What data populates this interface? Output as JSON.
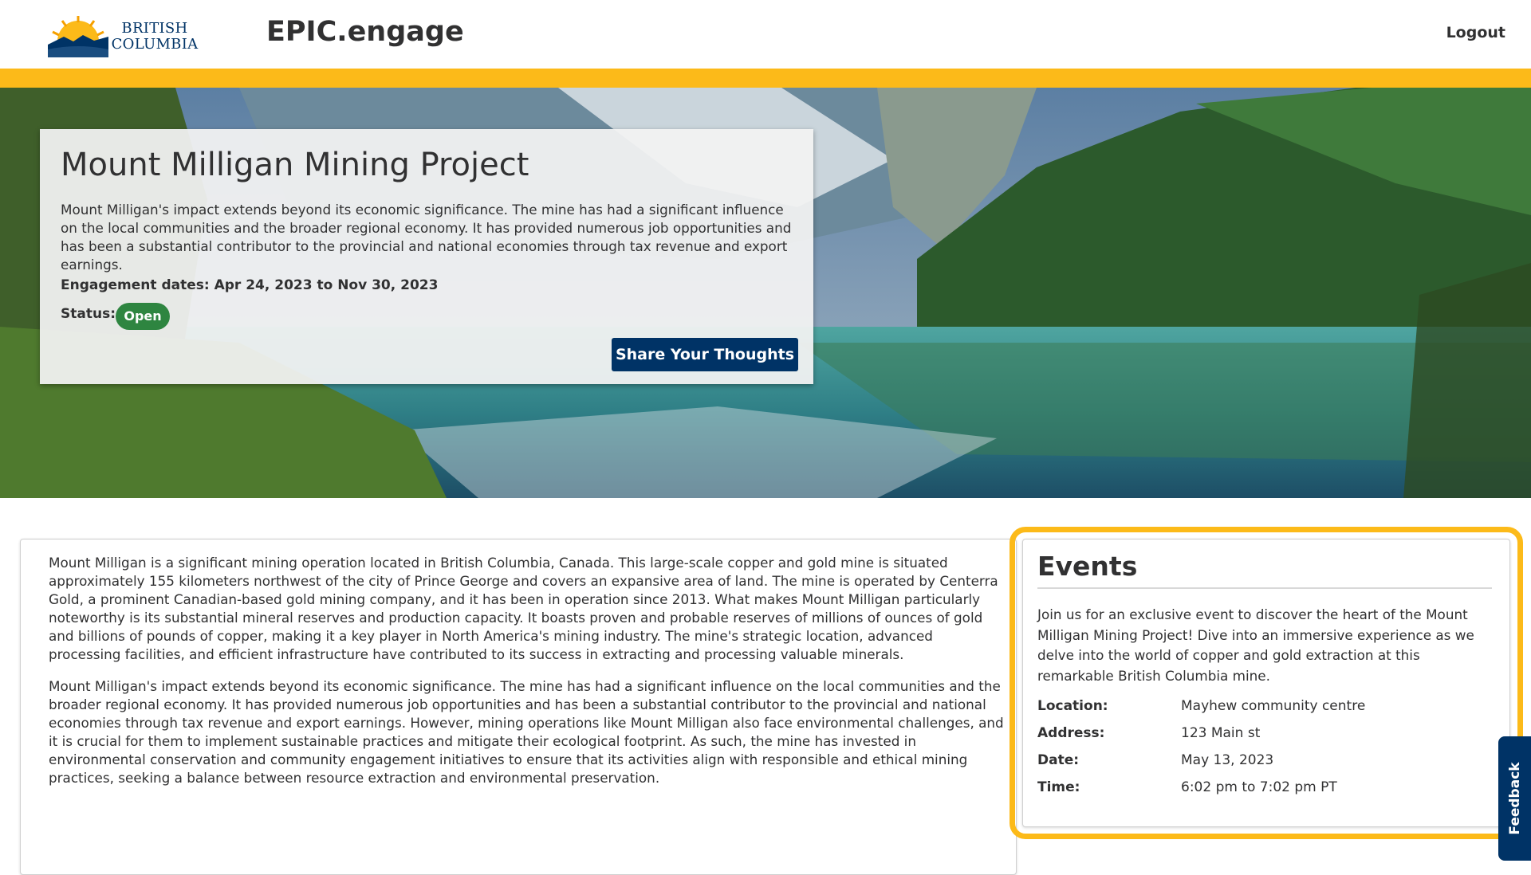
{
  "header": {
    "logo_line1": "BRITISH",
    "logo_line2": "COLUMBIA",
    "site_title": "EPIC.engage",
    "logout_label": "Logout"
  },
  "hero": {
    "title": "Mount Milligan Mining Project",
    "description": "Mount Milligan's impact extends beyond its economic significance. The mine has had a significant influence on the local communities and the broader regional economy. It has provided numerous job opportunities and has been a substantial contributor to the provincial and national economies through tax revenue and export earnings.",
    "engagement_dates": "Engagement dates: Apr 24, 2023 to Nov 30, 2023",
    "status_label": "Status:",
    "status_value": "Open",
    "cta_label": "Share Your Thoughts"
  },
  "content": {
    "paragraphs": [
      "Mount Milligan is a significant mining operation located in British Columbia, Canada. This large-scale copper and gold mine is situated approximately 155 kilometers northwest of the city of Prince George and covers an expansive area of land. The mine is operated by Centerra Gold, a prominent Canadian-based gold mining company, and it has been in operation since 2013. What makes Mount Milligan particularly noteworthy is its substantial mineral reserves and production capacity. It boasts proven and probable reserves of millions of ounces of gold and billions of pounds of copper, making it a key player in North America's mining industry. The mine's strategic location, advanced processing facilities, and efficient infrastructure have contributed to its success in extracting and processing valuable minerals.",
      "Mount Milligan's impact extends beyond its economic significance. The mine has had a significant influence on the local communities and the broader regional economy. It has provided numerous job opportunities and has been a substantial contributor to the provincial and national economies through tax revenue and export earnings. However, mining operations like Mount Milligan also face environmental challenges, and it is crucial for them to implement sustainable practices and mitigate their ecological footprint. As such, the mine has invested in environmental conservation and community engagement initiatives to ensure that its activities align with responsible and ethical mining practices, seeking a balance between resource extraction and environmental preservation."
    ]
  },
  "events": {
    "title": "Events",
    "description": "Join us for an exclusive event to discover the heart of the Mount Milligan Mining Project! Dive into an immersive experience as we delve into the world of copper and gold extraction at this remarkable British Columbia mine.",
    "details": [
      {
        "label": "Location:",
        "value": "Mayhew community centre"
      },
      {
        "label": "Address:",
        "value": "123 Main st"
      },
      {
        "label": "Date:",
        "value": "May 13, 2023"
      },
      {
        "label": "Time:",
        "value": "6:02 pm to 7:02 pm PT"
      }
    ]
  },
  "feedback": {
    "label": "Feedback"
  },
  "colors": {
    "brand_blue": "#003366",
    "brand_gold": "#fcba19",
    "status_green": "#2e8540"
  }
}
